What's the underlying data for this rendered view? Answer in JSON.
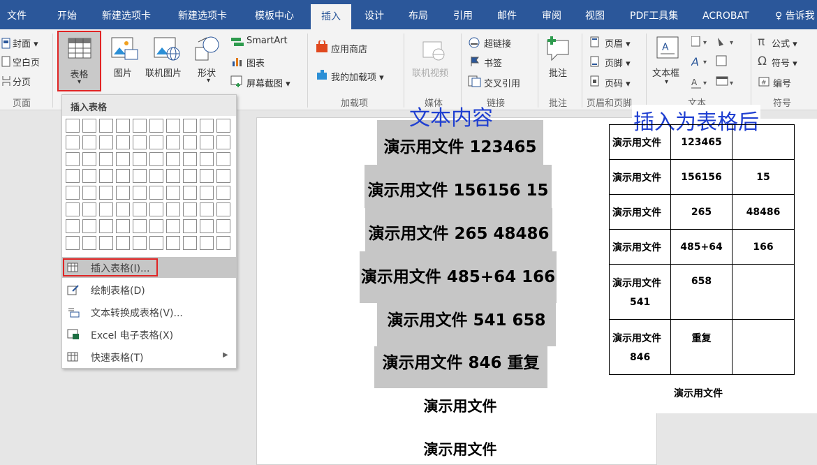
{
  "tabs": [
    "文件",
    "开始",
    "新建选项卡",
    "新建选项卡",
    "模板中心",
    "插入",
    "设计",
    "布局",
    "引用",
    "邮件",
    "审阅",
    "视图",
    "PDF工具集",
    "ACROBAT",
    "告诉我"
  ],
  "active_tab": "插入",
  "ribbon": {
    "pages": {
      "cover": "封面",
      "blank": "空白页",
      "break": "分页",
      "group": "页面"
    },
    "table": {
      "label": "表格"
    },
    "illustrations": {
      "picture": "图片",
      "online_picture": "联机图片",
      "shapes": "形状",
      "smartart": "SmartArt",
      "chart": "图表",
      "screenshot": "屏幕截图"
    },
    "addins": {
      "store": "应用商店",
      "my_addins": "我的加载项",
      "group": "加载项"
    },
    "media": {
      "online_video": "联机视频",
      "group": "媒体"
    },
    "links": {
      "hyperlink": "超链接",
      "bookmark": "书签",
      "crossref": "交叉引用",
      "group": "链接"
    },
    "comments": {
      "comment": "批注",
      "group": "批注"
    },
    "header_footer": {
      "header": "页眉",
      "footer": "页脚",
      "page_number": "页码",
      "group": "页眉和页脚"
    },
    "text": {
      "textbox": "文本框",
      "group": "文本"
    },
    "symbols": {
      "equation": "公式",
      "symbol": "符号",
      "numbering": "编号",
      "group": "符号"
    }
  },
  "dropdown": {
    "header": "插入表格",
    "items": [
      "插入表格(I)...",
      "绘制表格(D)",
      "文本转换成表格(V)...",
      "Excel 电子表格(X)",
      "快速表格(T)"
    ]
  },
  "annotations": {
    "source": "文本内容",
    "result": "插入为表格后"
  },
  "document": {
    "lines": [
      "演示用文件  123465",
      "演示用文件  156156 15",
      "演示用文件 265 48486",
      "演示用文件  485+64 166",
      "演示用文件 541 658",
      "演示用文件 846  重复"
    ],
    "plain": [
      "演示用文件",
      "演示用文件"
    ]
  },
  "result_table": {
    "rows": [
      [
        "演示用文件",
        "123465",
        ""
      ],
      [
        "演示用文件",
        "156156",
        "15"
      ],
      [
        "演示用文件",
        "265",
        "48486"
      ],
      [
        "演示用文件",
        "485+64",
        "166"
      ],
      [
        "演示用文件",
        "658",
        ""
      ],
      [
        "演示用文件",
        "重复",
        ""
      ]
    ],
    "wrap": [
      "",
      "",
      "",
      "",
      "541",
      "846"
    ],
    "below": "演示用文件"
  }
}
